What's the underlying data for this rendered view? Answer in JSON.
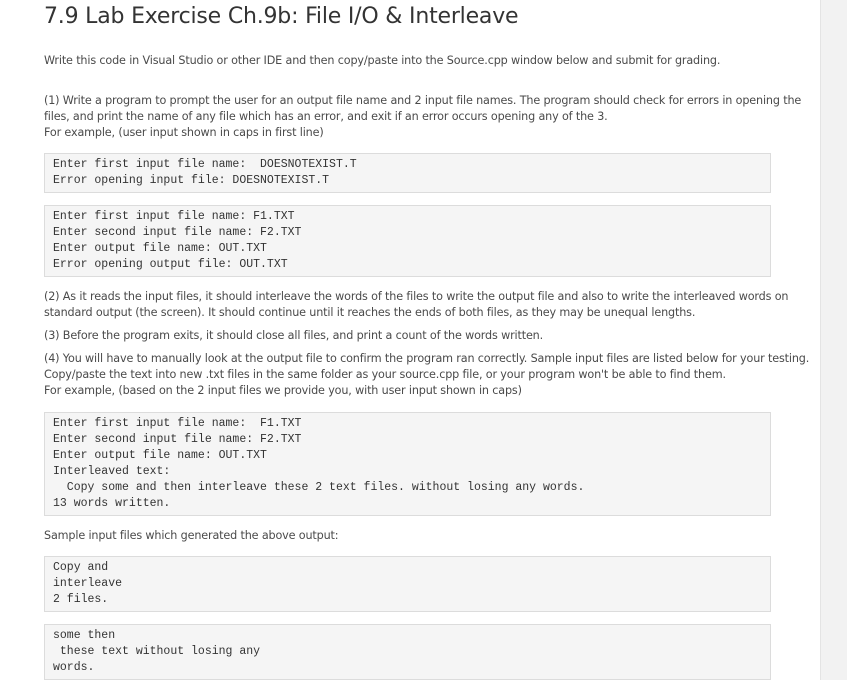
{
  "title": "7.9 Lab Exercise Ch.9b: File I/O & Interleave",
  "intro": "Write this code in Visual Studio or other IDE and then copy/paste into the Source.cpp window below and submit for grading.",
  "step1": [
    "(1) Write a program to prompt the user for an output file name and 2 input file names. The program should check for errors in opening the",
    "files, and print the name of any file which has an error, and exit if an error occurs opening any of the 3.",
    "For example, (user input shown in caps in first line)"
  ],
  "code1": [
    "Enter first input file name:  DOESNOTEXIST.T",
    "Error opening input file: DOESNOTEXIST.T"
  ],
  "code2": [
    "Enter first input file name: F1.TXT",
    "Enter second input file name: F2.TXT",
    "Enter output file name: OUT.TXT",
    "Error opening output file: OUT.TXT"
  ],
  "step2": [
    "(2) As it reads the input files, it should interleave the words of the files to write the output file and also to write the interleaved words on",
    "standard output (the screen). It should continue until it reaches the ends of both files, as they may be unequal lengths."
  ],
  "step3": [
    "(3) Before the program exits, it should close all files, and print a count of the words written."
  ],
  "step4": [
    "(4) You will have to manually look at the output file to confirm the program ran correctly. Sample input files are listed below for your testing.",
    "Copy/paste the text into new .txt files in the same folder as your source.cpp file, or your program won't be able to find them.",
    "For example, (based on the 2 input files we provide you, with user input shown in caps)"
  ],
  "code3": [
    "Enter first input file name:  F1.TXT",
    "Enter second input file name: F2.TXT",
    "Enter output file name: OUT.TXT",
    "Interleaved text:",
    "  Copy some and then interleave these 2 text files. without losing any words.",
    "13 words written."
  ],
  "sample_label": "Sample input files which generated the above output:",
  "code4": [
    "Copy and",
    "interleave",
    "2 files."
  ],
  "code5": [
    "some then",
    " these text without losing any",
    "words."
  ]
}
